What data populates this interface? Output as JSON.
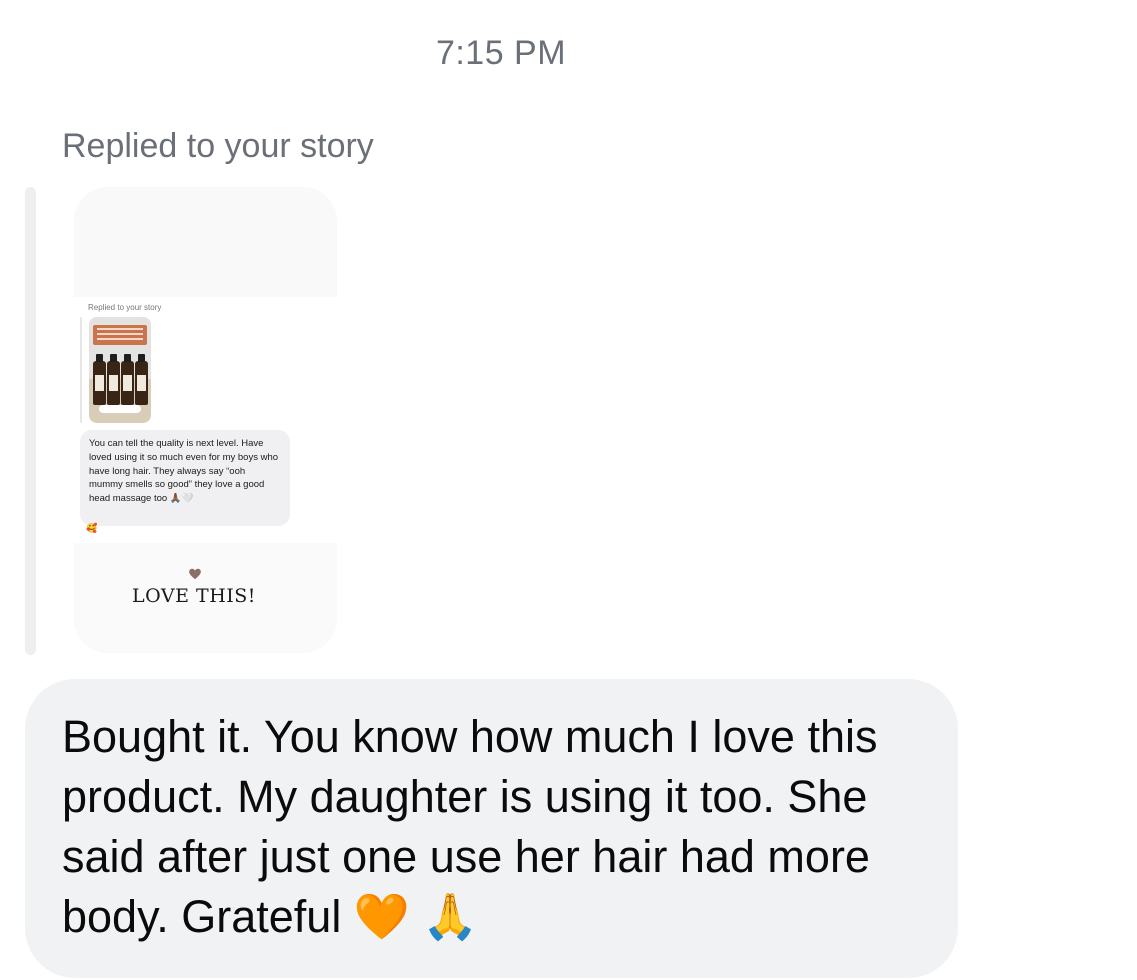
{
  "header": {
    "timestamp": "7:15 PM"
  },
  "reply": {
    "label": "Replied to your story"
  },
  "story": {
    "inner_label": "Replied to your story",
    "inner_message": "You can tell the quality is next level. Have loved using it so much even for my boys who have long hair. They always say “ooh mummy smells so good” they love a good head massage too 🙏🏾🤍",
    "inner_reaction": "🥰",
    "caption": "LOVE THIS!",
    "heart_color": "#8a6f68"
  },
  "message": {
    "text": "Bought it. You know how much I love this product. My daughter is using it too. She said after just one use her hair had more body. Grateful 🧡 🙏"
  },
  "colors": {
    "bubble_bg": "#f1f2f4",
    "secondary_text": "#6b7078"
  }
}
